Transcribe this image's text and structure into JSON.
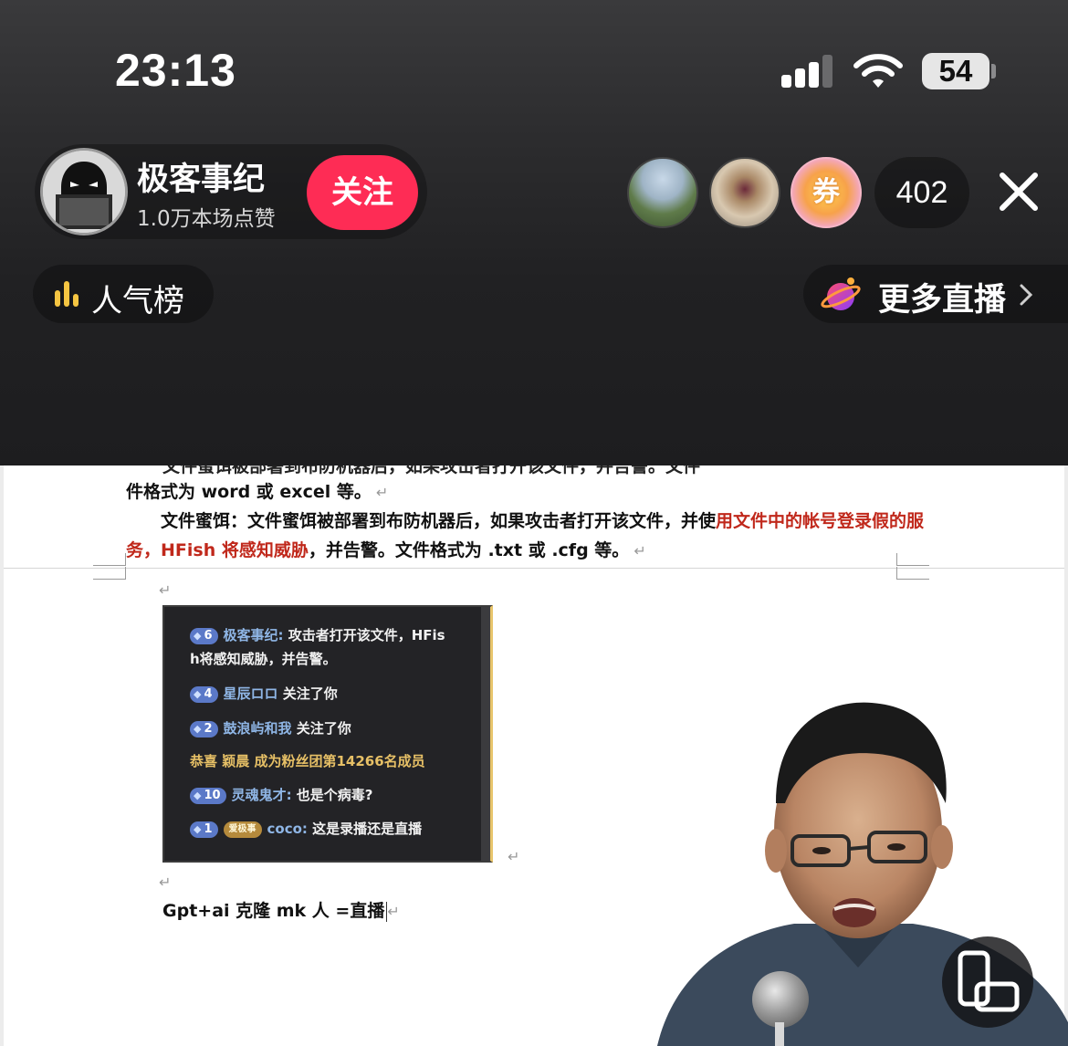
{
  "status_bar": {
    "time": "23:13",
    "battery": "54"
  },
  "host": {
    "name": "极客事纪",
    "likes": "1.0万本场点赞",
    "follow_label": "关注"
  },
  "viewers": {
    "coupon_label": "券",
    "count": "402"
  },
  "popularity": {
    "label": "人气榜"
  },
  "more_live": {
    "label": "更多直播"
  },
  "document": {
    "line_prev_partial": "文件蜜饵被部署到布防机器后，如果攻击者打开该文件，并告警。文件",
    "line_format_1": "件格式为 word 或 excel 等。",
    "para2_head": "文件蜜饵：文件蜜饵被部署到布防机器后，如果攻击者打开该文件，并使",
    "para2_red1": "用文件中的帐号登录假的服",
    "para2_red2": "务，HFish 将感知威胁",
    "para2_tail": "，并告警。文件格式为 .txt 或 .cfg 等。",
    "gpt_line": "Gpt+ai 克隆 mk 人  =直播"
  },
  "chat_screenshot": {
    "rows": [
      {
        "level": "6",
        "user": "极客事纪:",
        "text": " 攻击者打开该文件，HFis"
      },
      {
        "level": "",
        "user": "",
        "text": "h将感知威胁，并告警。"
      },
      {
        "level": "4",
        "user": "星辰ロロ",
        "text": "  关注了你"
      },
      {
        "level": "2",
        "user": "鼓浪屿和我",
        "text": "  关注了你"
      },
      {
        "level": "",
        "user": "",
        "text": "恭喜 颖晨 成为粉丝团第14266名成员"
      },
      {
        "level": "10",
        "user": "灵魂鬼才:",
        "text": " 也是个病毒?"
      },
      {
        "level": "1",
        "fan": "爱极事",
        "user": "coco:",
        "text": " 这是录播还是直播"
      }
    ]
  },
  "colors": {
    "follow": "#fe2c55",
    "doc_red": "#c0281b",
    "rank_icon": "#f5c542"
  }
}
